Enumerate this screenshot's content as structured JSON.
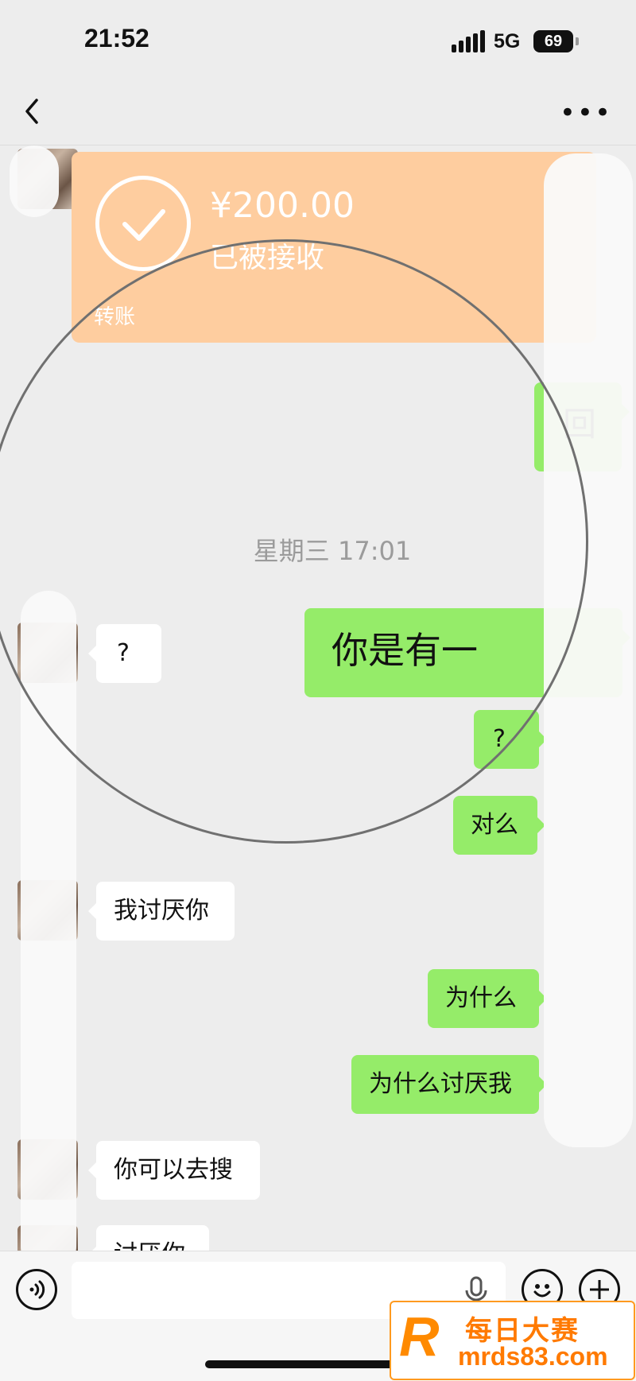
{
  "status_bar": {
    "time": "21:52",
    "network": "5G",
    "battery": "69"
  },
  "transfer": {
    "amount": "¥200.00",
    "status": "已被接收",
    "label": "转账"
  },
  "timestamp": "星期三 17:01",
  "messages": [
    {
      "side": "out",
      "text": "回"
    },
    {
      "side": "in",
      "text": "?"
    },
    {
      "side": "out",
      "text": "你是有一"
    },
    {
      "side": "out",
      "text": "?"
    },
    {
      "side": "out",
      "text": "对么"
    },
    {
      "side": "in",
      "text": "我讨厌你"
    },
    {
      "side": "out",
      "text": "为什么"
    },
    {
      "side": "out",
      "text": "为什么讨厌我"
    },
    {
      "side": "in",
      "text": "你可以去搜"
    },
    {
      "side": "in",
      "text": "讨厌你"
    }
  ],
  "watermark": {
    "logo": "R",
    "title": "每日大赛",
    "url": "mrds83.com"
  },
  "icons": {
    "back": "chevron-left-icon",
    "more": "more-dots-icon",
    "voice": "voice-icon",
    "mic": "mic-icon",
    "emoji": "emoji-icon",
    "plus": "plus-icon"
  },
  "colors": {
    "out_bubble": "#95ec69",
    "transfer_card": "#fecd9f",
    "background": "#ededed"
  }
}
